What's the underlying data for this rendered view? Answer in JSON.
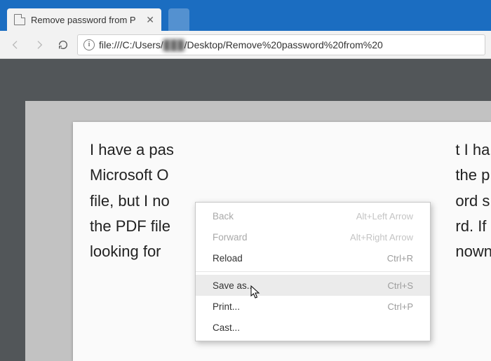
{
  "tab": {
    "title": "Remove password from P"
  },
  "address": {
    "url_prefix": "file:///C:/Users/",
    "url_blurred": "███",
    "url_suffix": "/Desktop/Remove%20password%20from%20"
  },
  "document": {
    "lines": [
      "I have a pas",
      "Microsoft O",
      "file, but I no",
      "the PDF file",
      "looking for"
    ],
    "lines_right": [
      "t I ha",
      "the p",
      "ord s",
      "rd. If",
      "nown"
    ]
  },
  "context_menu": {
    "items": [
      {
        "label": "Back",
        "shortcut": "Alt+Left Arrow",
        "disabled": true
      },
      {
        "label": "Forward",
        "shortcut": "Alt+Right Arrow",
        "disabled": true
      },
      {
        "label": "Reload",
        "shortcut": "Ctrl+R"
      },
      {
        "sep": true
      },
      {
        "label": "Save as...",
        "shortcut": "Ctrl+S",
        "hover": true
      },
      {
        "label": "Print...",
        "shortcut": "Ctrl+P"
      },
      {
        "label": "Cast..."
      }
    ]
  }
}
